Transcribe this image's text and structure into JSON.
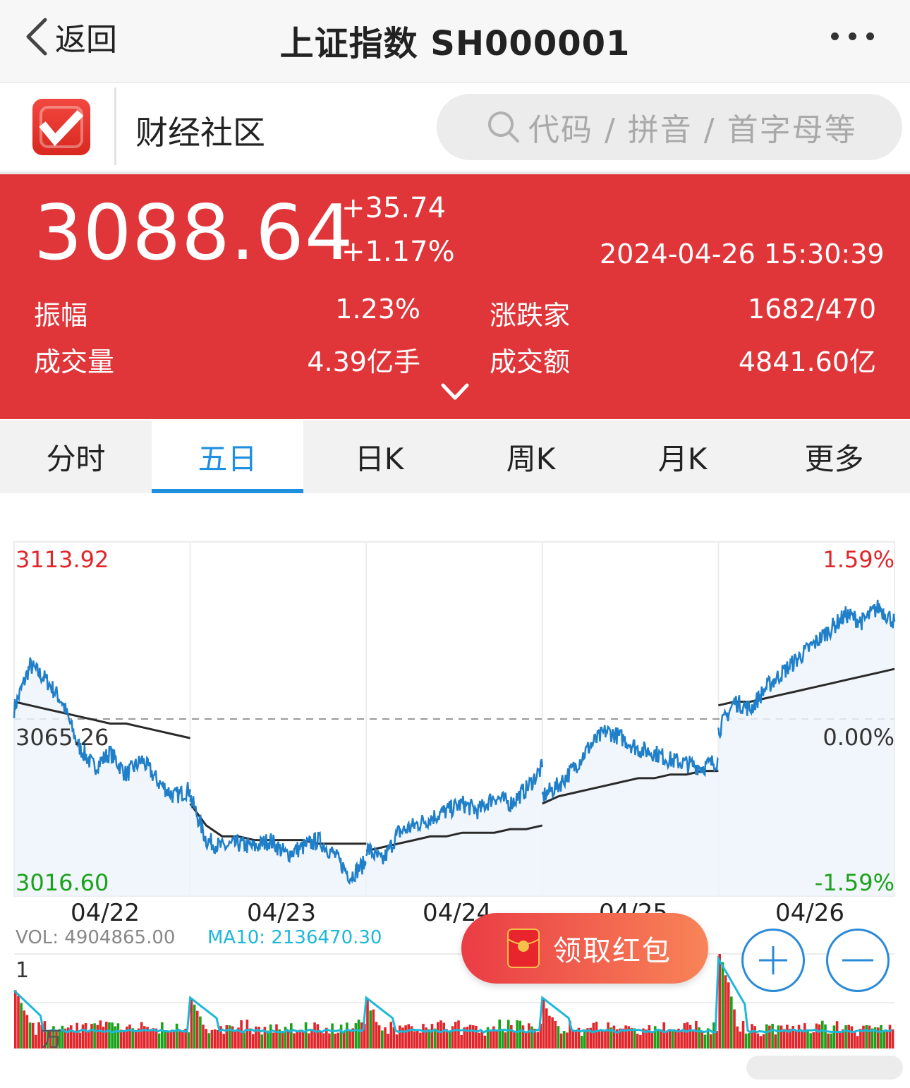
{
  "nav": {
    "back_label": "返回",
    "title": "上证指数 SH000001",
    "more_icon": "more-dots-icon"
  },
  "community": {
    "title": "财经社区",
    "search_placeholder": "代码 / 拼音 / 首字母等",
    "logo_icon": "v-logo-icon"
  },
  "quote": {
    "price": "3088.64",
    "change": "+35.74",
    "change_pct": "+1.17%",
    "time": "2024-04-26 15:30:39",
    "amplitude_label": "振幅",
    "amplitude": "1.23%",
    "advdec_label": "涨跌家",
    "advdec": "1682/470",
    "volume_label": "成交量",
    "volume": "4.39亿手",
    "turnover_label": "成交额",
    "turnover": "4841.60亿",
    "bg_color": "#e0363a"
  },
  "tabs": [
    {
      "label": "分时",
      "active": false
    },
    {
      "label": "五日",
      "active": true
    },
    {
      "label": "日K",
      "active": false
    },
    {
      "label": "周K",
      "active": false
    },
    {
      "label": "月K",
      "active": false
    },
    {
      "label": "更多",
      "active": false
    }
  ],
  "chart_data": {
    "type": "line",
    "y_max_label": "3113.92",
    "y_mid_label": "3065.26",
    "y_min_label": "3016.60",
    "pct_max_label": "1.59%",
    "pct_mid_label": "0.00%",
    "pct_min_label": "-1.59%",
    "ylim": [
      3016.6,
      3113.92
    ],
    "prev_close": 3065.26,
    "dates": [
      "04/22",
      "04/23",
      "04/24",
      "04/25",
      "04/26"
    ],
    "series": [
      {
        "color": "#1f7fc8",
        "values": [
          [
            3068,
            3080,
            3076,
            3070,
            3058,
            3052,
            3056,
            3050,
            3054,
            3048,
            3044,
            3046
          ],
          [
            3044,
            3032,
            3030,
            3031,
            3030,
            3032,
            3028,
            3030,
            3032,
            3028,
            3022,
            3026
          ],
          [
            3030,
            3026,
            3034,
            3036,
            3038,
            3040,
            3042,
            3040,
            3044,
            3042,
            3046,
            3052
          ],
          [
            3044,
            3047,
            3052,
            3058,
            3062,
            3060,
            3057,
            3056,
            3054,
            3053,
            3052,
            3054
          ],
          [
            3062,
            3070,
            3068,
            3074,
            3078,
            3082,
            3086,
            3090,
            3094,
            3092,
            3096,
            3092
          ]
        ]
      },
      {
        "color": "#2a2a2a",
        "values": [
          [
            3070,
            3069,
            3068,
            3067,
            3066,
            3065,
            3064,
            3064,
            3063,
            3062,
            3061,
            3060
          ],
          [
            3042,
            3036,
            3033,
            3033,
            3032,
            3032,
            3032,
            3032,
            3031,
            3031,
            3031,
            3031
          ],
          [
            3029,
            3030,
            3031,
            3032,
            3033,
            3033,
            3034,
            3034,
            3034,
            3035,
            3035,
            3036
          ],
          [
            3042,
            3044,
            3045,
            3046,
            3047,
            3048,
            3049,
            3049,
            3050,
            3050,
            3051,
            3051
          ],
          [
            3069,
            3070,
            3070,
            3071,
            3072,
            3073,
            3074,
            3075,
            3076,
            3077,
            3078,
            3079
          ]
        ]
      }
    ],
    "volume": {
      "vol_label": "VOL: 4904865.00",
      "ma10_label": "MA10: 2136470.30",
      "axis_top_label": "1",
      "axis_unit_label": "万",
      "ma_color": "#1db8d8",
      "up_color": "#e0262b",
      "down_color": "#1aa21a"
    }
  },
  "overlays": {
    "red_packet_label": "领取红包",
    "red_packet_icon": "red-envelope-icon",
    "zoom_in_icon": "plus-icon",
    "zoom_out_icon": "minus-icon"
  }
}
